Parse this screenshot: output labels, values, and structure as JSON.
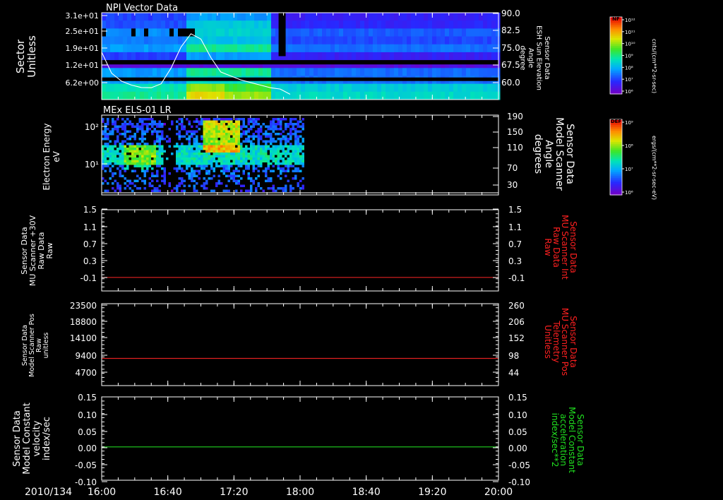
{
  "footer": {
    "date_label": "2010/134"
  },
  "chart_data": [
    {
      "type": "heatmap",
      "panel_title": "NPI Vector Data",
      "ylabel_left": [
        "Sector",
        "Unitless"
      ],
      "ytick_labels_left": [
        "3.1e+01",
        "2.5e+01",
        "1.9e+01",
        "1.2e+01",
        "6.2e+00"
      ],
      "ylabel_right": [
        "Sensor Data",
        "ESH Sun Elevation",
        "Angle",
        "degree"
      ],
      "ytick_labels_right": [
        "90.0",
        "82.5",
        "75.0",
        "67.5",
        "60.0"
      ],
      "ylim_right": [
        57,
        90
      ],
      "line_series": {
        "x": [
          "16:00",
          "16:06",
          "16:12",
          "16:18",
          "16:24",
          "16:30",
          "16:36",
          "16:42",
          "16:48",
          "16:54",
          "17:00",
          "17:06",
          "17:12",
          "17:18",
          "17:24",
          "17:30",
          "17:36",
          "17:42",
          "17:48",
          "17:54"
        ],
        "y": [
          75,
          67,
          64,
          62.5,
          61.6,
          61.5,
          63,
          69,
          77,
          82,
          80,
          73,
          67.5,
          66,
          64.5,
          63.5,
          62.5,
          61.5,
          61.0,
          59
        ]
      },
      "colorbar": {
        "label": "NF",
        "tick_labels": [
          "10¹²",
          "10¹¹",
          "10¹⁰",
          "10⁹",
          "10⁸",
          "10⁷",
          "10⁶"
        ],
        "units": "cnts/(cm**2-sr-sec)"
      }
    },
    {
      "type": "heatmap",
      "panel_title": "MEx ELS-01 LR",
      "ylabel_left": [
        "Electron Energy",
        "eV"
      ],
      "ytick_labels_left": [
        "10²",
        "10¹"
      ],
      "ylabel_right": [
        "Sensor Data",
        "Model Scanner",
        "Angle",
        "degrees"
      ],
      "ytick_labels_right": [
        "190",
        "150",
        "110",
        "70",
        "30"
      ],
      "ylim_right": [
        0,
        190
      ],
      "line_value": 0,
      "colorbar": {
        "label": "DEF",
        "tick_labels": [
          "10⁹",
          "10⁸",
          "10⁷",
          "10⁶"
        ],
        "units": "ergs/(cm**2-sr-sec-eV)"
      }
    },
    {
      "type": "line",
      "ylabel_left": [
        "Sensor Data",
        "MU Scanner +30V",
        "Raw Data",
        "Raw"
      ],
      "ytick_labels_left": [
        "1.5",
        "1.1",
        "0.7",
        "0.3",
        "-0.1"
      ],
      "ylim": [
        -0.3,
        1.5
      ],
      "ylabel_right": [
        "Sensor Data",
        "MU Scanner Int",
        "Raw Data",
        "Raw"
      ],
      "ytick_labels_right": [
        "1.5",
        "1.1",
        "0.7",
        "0.3",
        "-0.1"
      ],
      "series_value": 0.0,
      "line_color": "#e02020",
      "label_color": "#ff2020"
    },
    {
      "type": "line",
      "ylabel_left": [
        "Sensor Data",
        "Model Scanner Pos",
        "Raw",
        "unitless"
      ],
      "ytick_labels_left": [
        "23500",
        "18800",
        "14100",
        "9400",
        "4700"
      ],
      "ylim": [
        0,
        23500
      ],
      "ylabel_right": [
        "Sensor Data",
        "MU Scanner Pos",
        "Telemetry",
        "Unitless"
      ],
      "ytick_labels_right": [
        "260",
        "206",
        "152",
        "98",
        "44"
      ],
      "series_value": 7800,
      "line_color": "#e02020",
      "label_color": "#ff2020"
    },
    {
      "type": "line",
      "ylabel_left": [
        "Sensor Data",
        "Model Constant",
        "velocity",
        "index/sec"
      ],
      "ytick_labels_left": [
        "0.15",
        "0.10",
        "0.05",
        "0.00",
        "-0.05",
        "-0.10"
      ],
      "ylim": [
        -0.1,
        0.15
      ],
      "ylabel_right": [
        "Sensor Data",
        "Model Constant",
        "acceleration",
        "index/sec**2"
      ],
      "ytick_labels_right": [
        "0.15",
        "0.10",
        "0.05",
        "0.00",
        "-0.05",
        "-0.10"
      ],
      "series_value": 0.0,
      "line_color": "#20d020",
      "label_color": "#20e020"
    }
  ],
  "x_axis": {
    "tick_labels": [
      "16:00",
      "16:40",
      "17:20",
      "18:00",
      "18:40",
      "19:20",
      "20:00"
    ],
    "range": [
      "16:00",
      "20:00"
    ]
  }
}
